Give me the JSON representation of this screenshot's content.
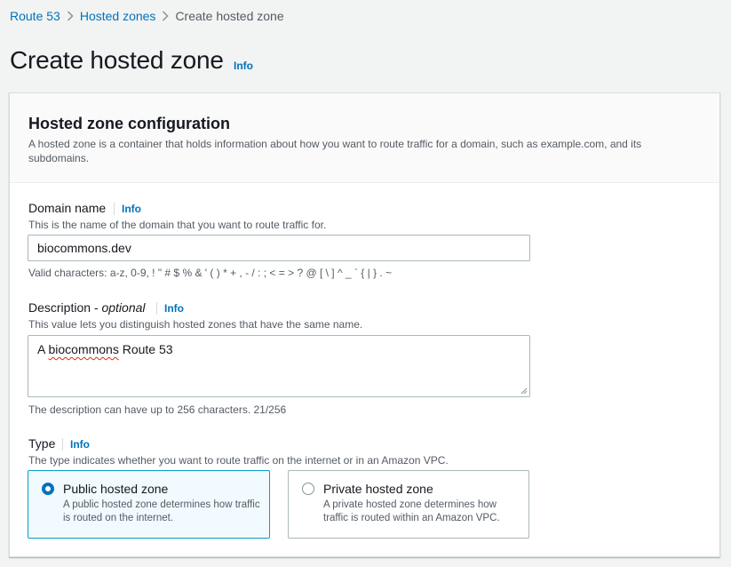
{
  "breadcrumb": {
    "items": [
      "Route 53",
      "Hosted zones",
      "Create hosted zone"
    ]
  },
  "page": {
    "title": "Create hosted zone",
    "info": "Info"
  },
  "panel": {
    "title": "Hosted zone configuration",
    "description": "A hosted zone is a container that holds information about how you want to route traffic for a domain, such as example.com, and its subdomains."
  },
  "domain": {
    "label": "Domain name",
    "info": "Info",
    "description": "This is the name of the domain that you want to route traffic for.",
    "value": "biocommons.dev",
    "constraint": "Valid characters: a-z, 0-9, ! \" # $ % & ' ( ) * + , - / : ; < = > ? @ [ \\ ] ^ _ ` { | } . ~"
  },
  "description_field": {
    "label": "Description - ",
    "label_optional": "optional",
    "info": "Info",
    "description": "This value lets you distinguish hosted zones that have the same name.",
    "value_prefix": "A ",
    "value_misspelled": "biocommons",
    "value_suffix": " Route 53",
    "constraint": "The description can have up to 256 characters. 21/256"
  },
  "type": {
    "label": "Type",
    "info": "Info",
    "description": "The type indicates whether you want to route traffic on the internet or in an Amazon VPC.",
    "options": [
      {
        "title": "Public hosted zone",
        "description": "A public hosted zone determines how traffic is routed on the internet.",
        "selected": true
      },
      {
        "title": "Private hosted zone",
        "description": "A private hosted zone determines how traffic is routed within an Amazon VPC.",
        "selected": false
      }
    ]
  },
  "colors": {
    "link": "#0073bb",
    "selected_border": "#00a1c9",
    "selected_bg": "#f1faff"
  }
}
